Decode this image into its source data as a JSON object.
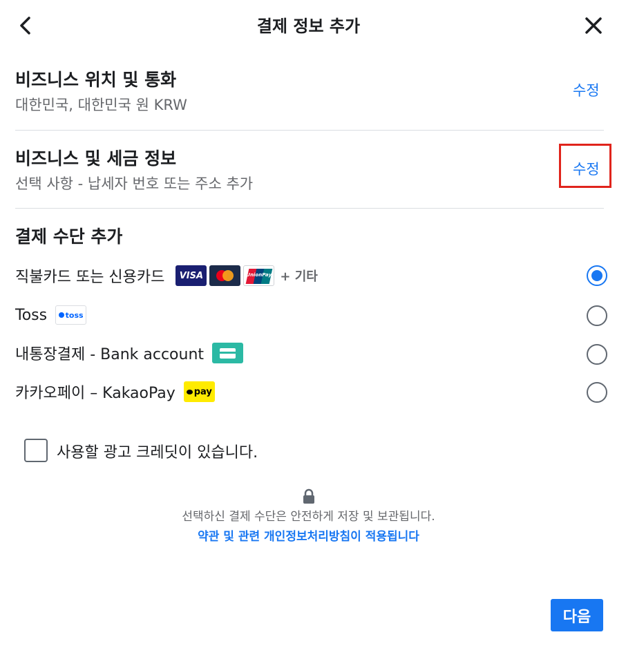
{
  "header": {
    "title": "결제 정보 추가",
    "back_icon": "chevron-left-icon",
    "close_icon": "close-icon"
  },
  "business_location": {
    "title": "비즈니스 위치 및 통화",
    "subtitle": "대한민국, 대한민국 원 KRW",
    "edit_label": "수정"
  },
  "business_tax": {
    "title": "비즈니스 및 세금 정보",
    "subtitle": "선택 사항 - 납세자 번호 또는 주소 추가",
    "edit_label": "수정"
  },
  "payment_methods": {
    "heading": "결제 수단 추가",
    "options": [
      {
        "label": "직불카드 또는 신용카드",
        "selected": true,
        "badges": [
          "VISA",
          "mastercard-icon",
          "unionpay-icon"
        ],
        "more": "+ 기타"
      },
      {
        "label": "Toss",
        "selected": false,
        "badge_text": "toss"
      },
      {
        "label": "내통장결제 - Bank account",
        "selected": false,
        "badge": "bank-card-icon"
      },
      {
        "label": "카카오페이 – KakaoPay",
        "selected": false,
        "badge_text": "pay"
      }
    ]
  },
  "ad_credit": {
    "label": "사용할 광고 크레딧이 있습니다.",
    "checked": false
  },
  "security": {
    "text": "선택하신 결제 수단은 안전하게 저장 및 보관됩니다.",
    "policy_link": "약관 및 관련 개인정보처리방침이 적용됩니다"
  },
  "footer": {
    "next_label": "다음"
  },
  "colors": {
    "accent": "#1877f2",
    "highlight_border": "#e0241c",
    "muted_text": "#65676b"
  }
}
